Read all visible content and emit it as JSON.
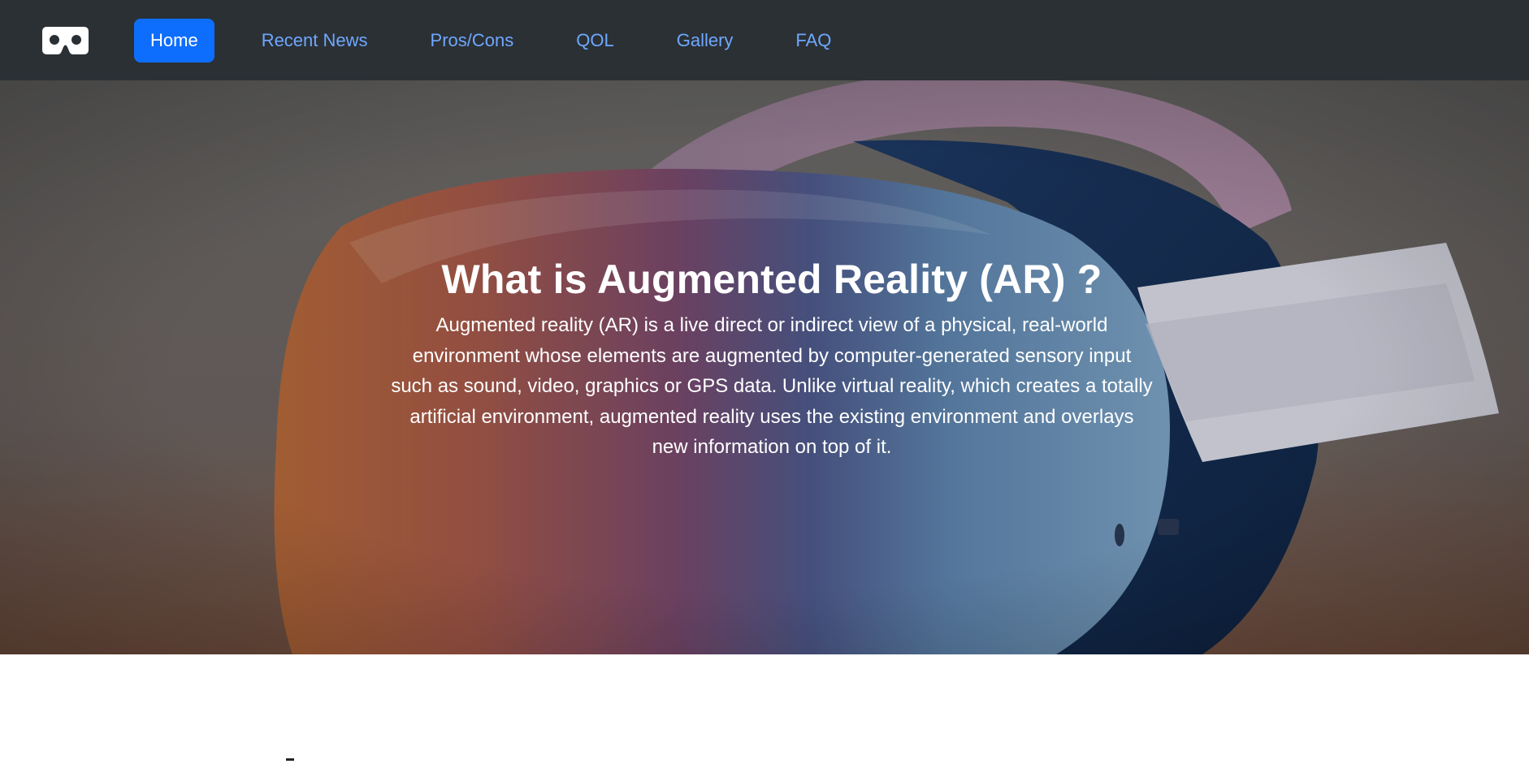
{
  "nav": {
    "logo_icon": "vr-headset-icon",
    "items": [
      {
        "label": "Home",
        "active": true
      },
      {
        "label": "Recent News",
        "active": false
      },
      {
        "label": "Pros/Cons",
        "active": false
      },
      {
        "label": "QOL",
        "active": false
      },
      {
        "label": "Gallery",
        "active": false
      },
      {
        "label": "FAQ",
        "active": false
      }
    ]
  },
  "hero": {
    "title": "What is Augmented Reality (AR) ?",
    "text": "Augmented reality (AR) is a live direct or indirect view of a physical, real-world environment whose elements are augmented by computer-generated sensory input such as sound, video, graphics or GPS data. Unlike virtual reality, which creates a totally artificial environment, augmented reality uses the existing environment and overlays new information on top of it.",
    "image_subject": "vr-headset-photo"
  },
  "colors": {
    "navbar_bg": "#2b3035",
    "nav_link": "#6ea8fe",
    "nav_active_bg": "#0d6efd",
    "hero_text": "#ffffff"
  }
}
